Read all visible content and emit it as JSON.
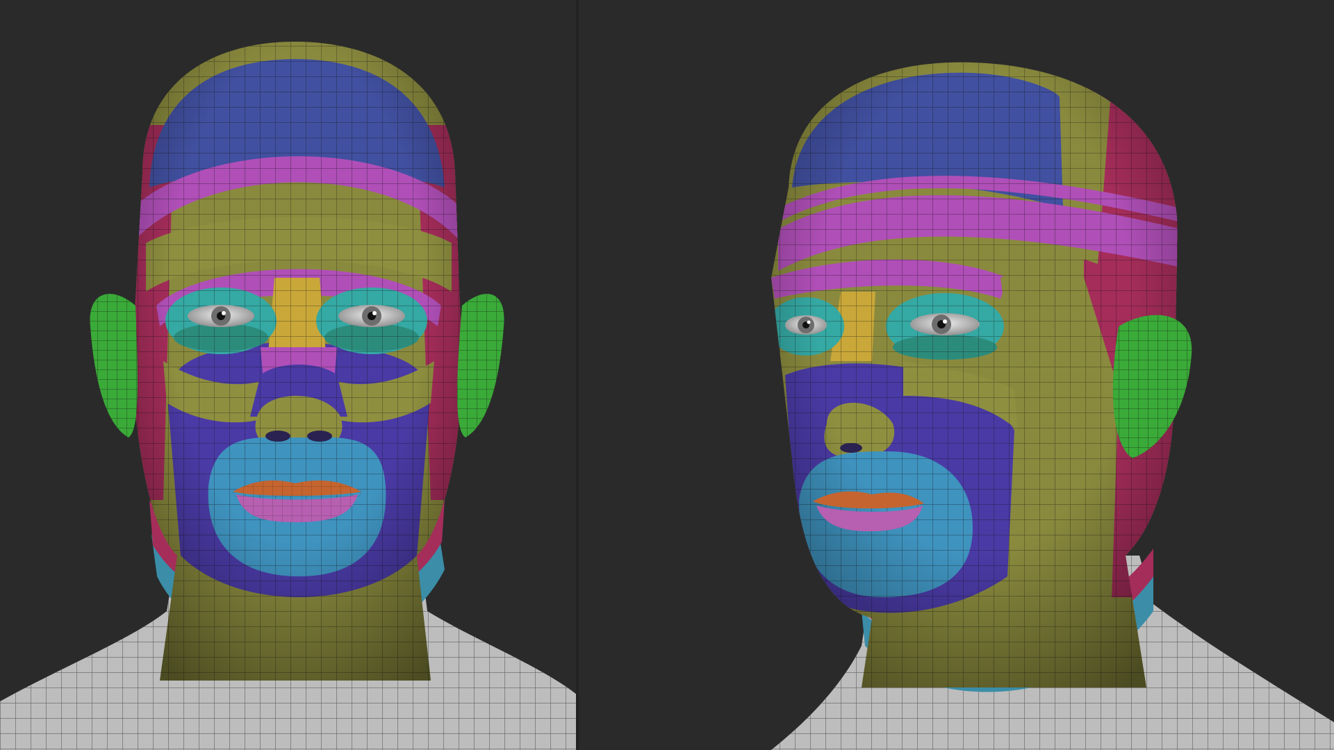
{
  "scene": {
    "background": "#2a2a2a",
    "views": [
      {
        "name": "front-view"
      },
      {
        "name": "three-quarter-view"
      }
    ],
    "region_colors": {
      "neck": "#b9b9b9",
      "scalp_blue": "#4150a0",
      "band_magenta": "#b04fb8",
      "band_olive": "#8a8a3e",
      "band_crimson": "#a52d5a",
      "face_indigo": "#4a3aa5",
      "mouth_cyan": "#3f93bf",
      "eye_teal": "#35a9a4",
      "lip_orange": "#c5642e",
      "lip_pink": "#b75fb0",
      "ear_green": "#3aaa38",
      "nose_olive": "#8f8f40",
      "bridge_yellow": "#c9a739",
      "neck_teal": "#3b8da8"
    }
  }
}
